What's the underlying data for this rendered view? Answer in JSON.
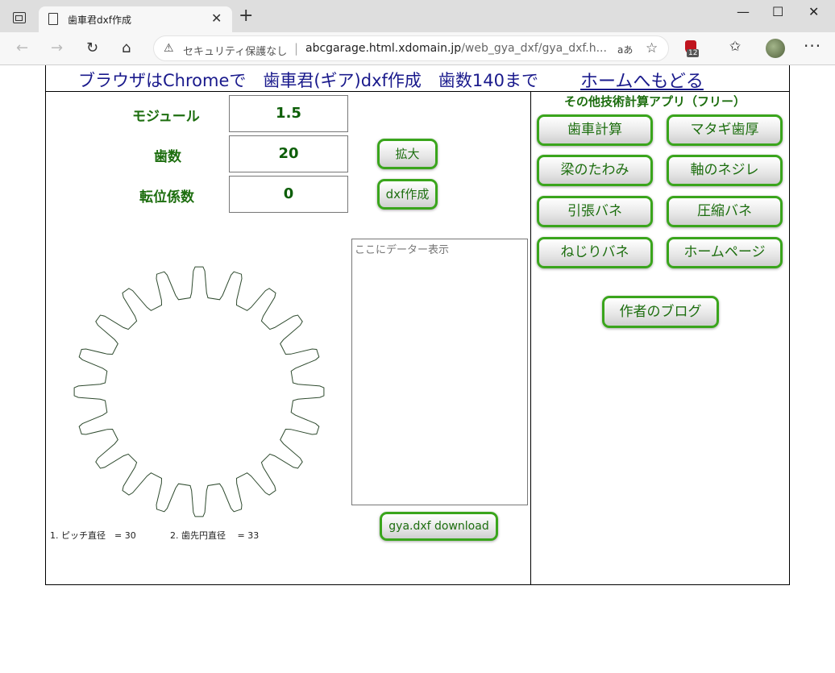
{
  "browser": {
    "tab_title": "歯車君dxf作成",
    "security_label": "セキュリティ保護なし",
    "url_domain": "abcgarage.html.xdomain.jp",
    "url_path": "/web_gya_dxf/gya_dxf.h...",
    "reader_label": "aあ",
    "extension_badge": "12"
  },
  "header": {
    "title": "ブラウザはChromeで　歯車君(ギア)dxf作成　歯数140まで",
    "home_link": "ホームへもどる"
  },
  "form": {
    "module_label": "モジュール",
    "module_value": "1.5",
    "teeth_label": "歯数",
    "teeth_value": "20",
    "shift_label": "転位係数",
    "shift_value": "0",
    "zoom_button": "拡大",
    "dxf_button": "dxf作成",
    "data_placeholder": "ここにデーター表示",
    "download_button": "gya.dxf download"
  },
  "results": {
    "pitch_diameter": "1. ピッチ直径　= 30",
    "tip_diameter": "2. 歯先円直径　 = 33"
  },
  "gear_drawing": {
    "teeth": 20,
    "stroke_color": "#2e4a2e"
  },
  "sidebar": {
    "title": "その他技術計算アプリ（フリー）",
    "apps": [
      "歯車計算",
      "マタギ歯厚",
      "梁のたわみ",
      "軸のネジレ",
      "引張バネ",
      "圧縮バネ",
      "ねじりバネ",
      "ホームページ"
    ],
    "blog_button": "作者のブログ"
  },
  "colors": {
    "accent_green": "#3aa51c",
    "label_green": "#1d6e0f",
    "title_navy": "#1a1a8c"
  }
}
